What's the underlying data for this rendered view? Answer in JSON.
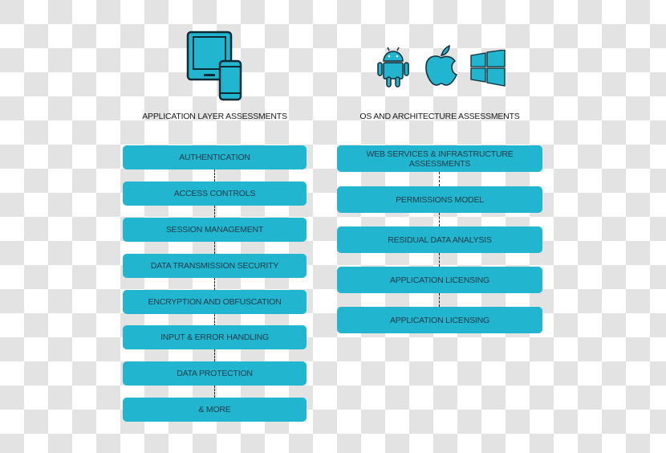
{
  "colors": {
    "accent": "#21b5d0",
    "icon_stroke": "#0e2a33",
    "text": "#1a1a1a",
    "box_text": "#1d3b47"
  },
  "left_column": {
    "icon": "tablet-and-phone-icon",
    "heading": "APPLICATION LAYER ASSESSMENTS",
    "items": [
      {
        "label": "AUTHENTICATION"
      },
      {
        "label": "ACCESS CONTROLS"
      },
      {
        "label": "SESSION MANAGEMENT"
      },
      {
        "label": "DATA TRANSMISSION SECURITY"
      },
      {
        "label": "ENCRYPTION AND OBFUSCATION"
      },
      {
        "label": "INPUT & ERROR HANDLING"
      },
      {
        "label": "DATA PROTECTION"
      },
      {
        "label": "& MORE"
      }
    ]
  },
  "right_column": {
    "icons": [
      "android-icon",
      "apple-icon",
      "windows-icon"
    ],
    "heading": "OS AND ARCHITECTURE ASSESSMENTS",
    "items": [
      {
        "label": "WEB SERVICES & INFRASTRUCTURE ASSESSMENTS"
      },
      {
        "label": "PERMISSIONS MODEL"
      },
      {
        "label": "RESIDUAL DATA ANALYSIS"
      },
      {
        "label": "APPLICATION LICENSING"
      },
      {
        "label": "APPLICATION LICENSING"
      }
    ]
  }
}
